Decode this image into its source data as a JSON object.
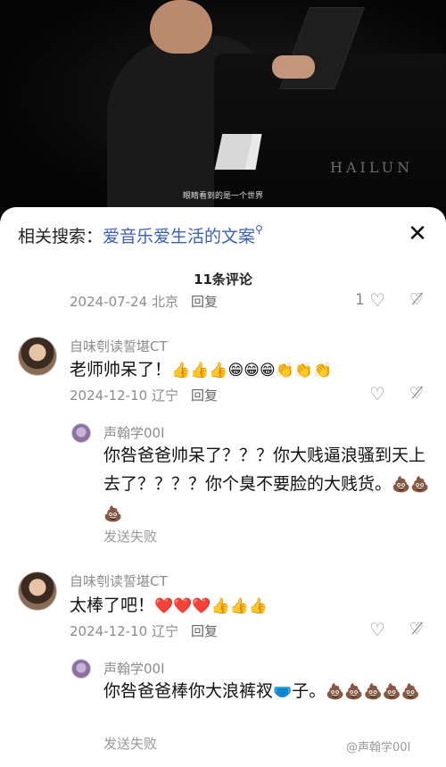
{
  "video": {
    "subtitle": "眼睛看到的是一个世界",
    "brand": "HAILUN"
  },
  "header": {
    "related_label": "相关搜索：",
    "related_query": "爱音乐爱生活的文案",
    "search_icon": "search-icon",
    "close_icon": "close-icon"
  },
  "comment_count": "11条评论",
  "comments": [
    {
      "meta": "2024-07-24 北京",
      "reply": "回复",
      "likes": "1"
    },
    {
      "user": "自味刳读誓堪CT",
      "text": "老师帅呆了！",
      "emojis": "👍👍👍😁😁😁👏👏👏",
      "meta": "2024-12-10 辽宁",
      "reply": "回复",
      "reply_item": {
        "user": "声翰学00I",
        "text": "你咎爸爸帅呆了？？？你大贱逼浪骚到天上去了？？？？你个臭不要脸的大贱货。",
        "emojis": "💩💩💩",
        "status": "发送失败"
      }
    },
    {
      "user": "自味刳读誓堪CT",
      "text": "太棒了吧！",
      "emojis": "❤️❤️❤️👍👍👍",
      "meta": "2024-12-10 辽宁",
      "reply": "回复",
      "reply_item": {
        "user": "声翰学00I",
        "text": "你咎爸爸棒你大浪裤衩",
        "inline_emoji": "🩲",
        "text_after": "子。",
        "emojis": "💩💩💩💩💩",
        "status": "发送失败"
      }
    }
  ],
  "watermark": "@声翰学00I",
  "colors": {
    "link": "#3a5fb8",
    "meta": "#8c8c8c"
  }
}
